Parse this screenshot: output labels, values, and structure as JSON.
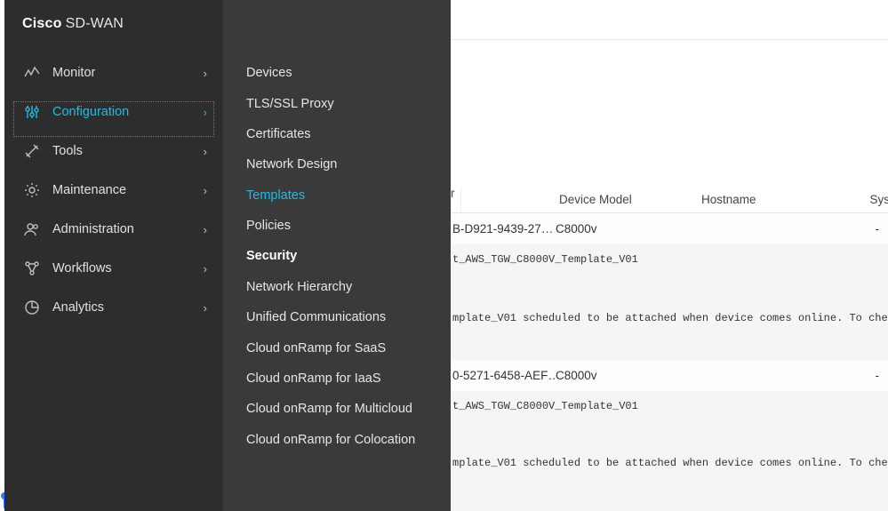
{
  "brand": {
    "cisco": "Cisco",
    "product": "SD-WAN"
  },
  "sidebar": {
    "items": [
      {
        "label": "Monitor"
      },
      {
        "label": "Configuration"
      },
      {
        "label": "Tools"
      },
      {
        "label": "Maintenance"
      },
      {
        "label": "Administration"
      },
      {
        "label": "Workflows"
      },
      {
        "label": "Analytics"
      }
    ]
  },
  "submenu": {
    "items": [
      {
        "label": "Devices"
      },
      {
        "label": "TLS/SSL Proxy"
      },
      {
        "label": "Certificates"
      },
      {
        "label": "Network Design"
      },
      {
        "label": "Templates"
      },
      {
        "label": "Policies"
      },
      {
        "label": "Security"
      },
      {
        "label": "Network Hierarchy"
      },
      {
        "label": "Unified Communications"
      },
      {
        "label": "Cloud onRamp for SaaS"
      },
      {
        "label": "Cloud onRamp for IaaS"
      },
      {
        "label": "Cloud onRamp for Multicloud"
      },
      {
        "label": "Cloud onRamp for Colocation"
      }
    ]
  },
  "table": {
    "headers": {
      "r": "r",
      "device_model": "Device Model",
      "hostname": "Hostname",
      "sys": "Sys"
    },
    "rows": [
      {
        "guid": "B-D921-9439-27…",
        "device_model": "C8000v",
        "hostname": "",
        "dash": "-",
        "desc_line1": "t_AWS_TGW_C8000V_Template_V01",
        "desc_line2": "mplate_V01 scheduled to be attached when device comes online. To check the synced sta"
      },
      {
        "guid": "0-5271-6458-AEF…",
        "device_model": "C8000v",
        "hostname": "",
        "dash": "-",
        "desc_line1": "t_AWS_TGW_C8000V_Template_V01",
        "desc_line2": "mplate_V01 scheduled to be attached when device comes online. To check the synced sta"
      }
    ]
  }
}
